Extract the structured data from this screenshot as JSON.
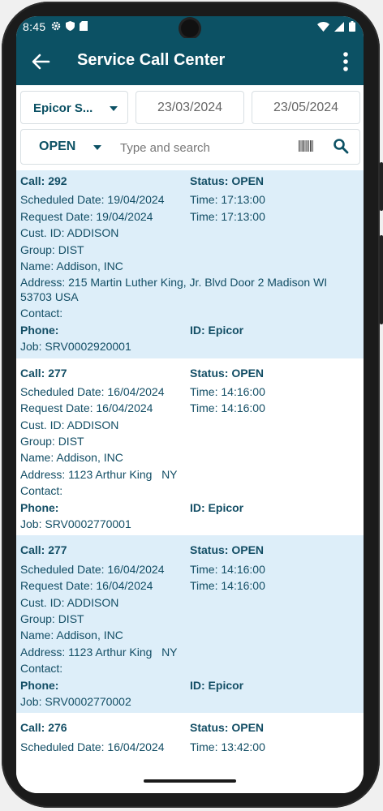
{
  "statusbar": {
    "time": "8:45"
  },
  "appbar": {
    "title": "Service Call Center",
    "back_icon": "arrow-left-icon",
    "menu_icon": "more-vert-icon"
  },
  "filters": {
    "company": "Epicor S...",
    "date_from": "23/03/2024",
    "date_to": "23/05/2024",
    "status": "OPEN",
    "search_placeholder": "Type and search"
  },
  "calls": [
    {
      "call": "Call: 292",
      "status": "Status: OPEN",
      "scheduled": "Scheduled Date: 19/04/2024",
      "sched_time": "Time: 17:13:00",
      "request": "Request Date: 19/04/2024",
      "req_time": "Time: 17:13:00",
      "cust": "Cust. ID: ADDISON",
      "group": "Group: DIST",
      "name": "Name: Addison, INC",
      "address": "Address: 215 Martin Luther King, Jr. Blvd Door 2  Madison WI 53703 USA",
      "contact": "Contact:",
      "phone": "Phone:",
      "id": "ID: Epicor",
      "job": "Job: SRV0002920001",
      "shaded": true
    },
    {
      "call": "Call: 277",
      "status": "Status: OPEN",
      "scheduled": "Scheduled Date: 16/04/2024",
      "sched_time": "Time: 14:16:00",
      "request": "Request Date: 16/04/2024",
      "req_time": "Time: 14:16:00",
      "cust": "Cust. ID: ADDISON",
      "group": "Group: DIST",
      "name": "Name: Addison, INC",
      "address": "Address: 1123 Arthur King   NY",
      "contact": "Contact:",
      "phone": "Phone:",
      "id": "ID: Epicor",
      "job": "Job: SRV0002770001",
      "shaded": false
    },
    {
      "call": "Call: 277",
      "status": "Status: OPEN",
      "scheduled": "Scheduled Date: 16/04/2024",
      "sched_time": "Time: 14:16:00",
      "request": "Request Date: 16/04/2024",
      "req_time": "Time: 14:16:00",
      "cust": "Cust. ID: ADDISON",
      "group": "Group: DIST",
      "name": "Name: Addison, INC",
      "address": "Address: 1123 Arthur King   NY",
      "contact": "Contact:",
      "phone": "Phone:",
      "id": "ID: Epicor",
      "job": "Job: SRV0002770002",
      "shaded": true
    },
    {
      "call": "Call: 276",
      "status": "Status: OPEN",
      "scheduled": "Scheduled Date: 16/04/2024",
      "sched_time": "Time: 13:42:00",
      "shaded": false
    }
  ],
  "colors": {
    "primary": "#0c5164",
    "card_shade": "#ddeef9",
    "text": "#134e65"
  }
}
